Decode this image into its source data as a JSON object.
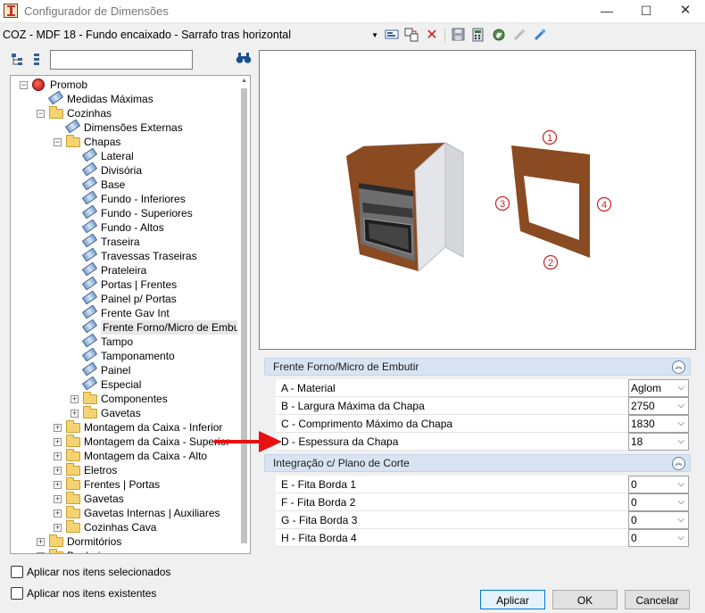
{
  "window": {
    "title": "Configurador de Dimensões",
    "min_glyph": "—",
    "max_glyph": "☐",
    "close_glyph": "✕"
  },
  "toolbar": {
    "config_value": "COZ - MDF 18 - Fundo encaixado - Sarrafo tras horizontal",
    "dropdown_glyph": "▼",
    "icons": [
      "edit-form-icon",
      "copy-icon",
      "delete-icon",
      "save-icon",
      "calculator-icon",
      "settings-icon",
      "link-icon",
      "link-edit-icon"
    ]
  },
  "tree": {
    "search_value": "",
    "items": [
      {
        "label": "Promob",
        "level": 0,
        "icon": "root",
        "expander": "−"
      },
      {
        "label": "Medidas Máximas",
        "level": 1,
        "icon": "ruler"
      },
      {
        "label": "Cozinhas",
        "level": 1,
        "icon": "folder",
        "expander": "−"
      },
      {
        "label": "Dimensões Externas",
        "level": 2,
        "icon": "ruler"
      },
      {
        "label": "Chapas",
        "level": 2,
        "icon": "folder",
        "expander": "−"
      },
      {
        "label": "Lateral",
        "level": 3,
        "icon": "ruler"
      },
      {
        "label": "Divisória",
        "level": 3,
        "icon": "ruler"
      },
      {
        "label": "Base",
        "level": 3,
        "icon": "ruler"
      },
      {
        "label": "Fundo - Inferiores",
        "level": 3,
        "icon": "ruler"
      },
      {
        "label": "Fundo - Superiores",
        "level": 3,
        "icon": "ruler"
      },
      {
        "label": "Fundo - Altos",
        "level": 3,
        "icon": "ruler"
      },
      {
        "label": "Traseira",
        "level": 3,
        "icon": "ruler"
      },
      {
        "label": "Travessas Traseiras",
        "level": 3,
        "icon": "ruler"
      },
      {
        "label": "Prateleira",
        "level": 3,
        "icon": "ruler"
      },
      {
        "label": "Portas | Frentes",
        "level": 3,
        "icon": "ruler"
      },
      {
        "label": "Painel p/ Portas",
        "level": 3,
        "icon": "ruler"
      },
      {
        "label": "Frente Gav Int",
        "level": 3,
        "icon": "ruler"
      },
      {
        "label": "Frente Forno/Micro de Embutir",
        "level": 3,
        "icon": "ruler",
        "selected": true
      },
      {
        "label": "Tampo",
        "level": 3,
        "icon": "ruler"
      },
      {
        "label": "Tamponamento",
        "level": 3,
        "icon": "ruler"
      },
      {
        "label": "Painel",
        "level": 3,
        "icon": "ruler"
      },
      {
        "label": "Especial",
        "level": 3,
        "icon": "ruler"
      },
      {
        "label": "Componentes",
        "level": 3,
        "icon": "folder",
        "expander": "+"
      },
      {
        "label": "Gavetas",
        "level": 3,
        "icon": "folder",
        "expander": "+"
      },
      {
        "label": "Montagem da Caixa - Inferior",
        "level": 2,
        "icon": "folder",
        "expander": "+"
      },
      {
        "label": "Montagem da Caixa - Superior",
        "level": 2,
        "icon": "folder",
        "expander": "+"
      },
      {
        "label": "Montagem da Caixa - Alto",
        "level": 2,
        "icon": "folder",
        "expander": "+"
      },
      {
        "label": "Eletros",
        "level": 2,
        "icon": "folder",
        "expander": "+"
      },
      {
        "label": "Frentes | Portas",
        "level": 2,
        "icon": "folder",
        "expander": "+"
      },
      {
        "label": "Gavetas",
        "level": 2,
        "icon": "folder",
        "expander": "+"
      },
      {
        "label": "Gavetas Internas | Auxiliares",
        "level": 2,
        "icon": "folder",
        "expander": "+"
      },
      {
        "label": "Cozinhas Cava",
        "level": 2,
        "icon": "folder",
        "expander": "+"
      },
      {
        "label": "Dormitórios",
        "level": 1,
        "icon": "folder",
        "expander": "+"
      },
      {
        "label": "Banheiros",
        "level": 1,
        "icon": "folder",
        "expander": "+"
      }
    ]
  },
  "preview": {
    "markers": [
      "1",
      "2",
      "3",
      "4"
    ],
    "wood_color": "#8a4a22",
    "oven_color": "#6e6e6e"
  },
  "groups": [
    {
      "title": "Frente Forno/Micro de Embutir",
      "collapse_glyph": "︽",
      "rows": [
        {
          "label": "A - Material",
          "value": "Aglom"
        },
        {
          "label": "B - Largura Máxima da Chapa",
          "value": "2750"
        },
        {
          "label": "C - Comprimento Máximo da Chapa",
          "value": "1830"
        },
        {
          "label": "D - Espessura da Chapa",
          "value": "18"
        }
      ]
    },
    {
      "title": "Integração c/ Plano de Corte",
      "collapse_glyph": "︽",
      "rows": [
        {
          "label": "E - Fita Borda 1",
          "value": "0"
        },
        {
          "label": "F - Fita Borda 2",
          "value": "0"
        },
        {
          "label": "G - Fita Borda 3",
          "value": "0"
        },
        {
          "label": "H - Fita Borda 4",
          "value": "0"
        }
      ]
    }
  ],
  "dropdown_glyph": "⌵",
  "annotation_color": "#e81010",
  "footer": {
    "apply_selected": "Aplicar nos itens selecionados",
    "apply_existing": "Aplicar nos itens existentes",
    "apply": "Aplicar",
    "ok": "OK",
    "cancel": "Cancelar"
  }
}
